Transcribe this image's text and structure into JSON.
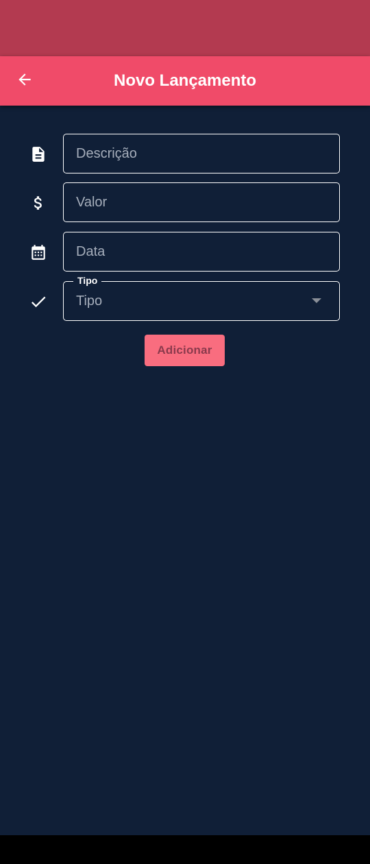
{
  "app_bar": {
    "title": "Novo Lançamento",
    "back_icon": "arrow-back-icon"
  },
  "form": {
    "descricao": {
      "icon": "document-icon",
      "placeholder": "Descrição",
      "value": ""
    },
    "valor": {
      "icon": "dollar-icon",
      "placeholder": "Valor",
      "value": ""
    },
    "data": {
      "icon": "calendar-icon",
      "placeholder": "Data",
      "value": ""
    },
    "tipo": {
      "icon": "check-icon",
      "label": "Tipo",
      "value": "Tipo"
    }
  },
  "actions": {
    "add_label": "Adicionar"
  },
  "colors": {
    "status_bar": "#b33a50",
    "app_bar": "#f04b69",
    "background": "#101f37",
    "button": "#f96d7f",
    "button_text": "#8a3a4c"
  }
}
